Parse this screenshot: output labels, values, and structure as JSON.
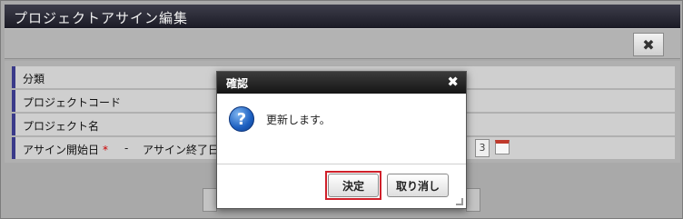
{
  "window": {
    "title": "プロジェクトアサイン編集",
    "close_symbol": "✖"
  },
  "form": {
    "rows": [
      {
        "label": "分類"
      },
      {
        "label": "プロジェクトコード"
      },
      {
        "label": "プロジェクト名"
      },
      {
        "label": "アサイン開始日",
        "required": "*",
        "separator": "-",
        "label2": "アサイン終了日",
        "date_fragment": "3"
      }
    ]
  },
  "dialog": {
    "title": "確認",
    "close_symbol": "✖",
    "icon": "question-icon",
    "icon_glyph": "?",
    "message": "更新します。",
    "ok_label": "決定",
    "cancel_label": "取り消し"
  },
  "colors": {
    "ok_highlight": "#d0202a",
    "titlebar": "#1b1b26",
    "row_accent": "#3a3a8a"
  }
}
